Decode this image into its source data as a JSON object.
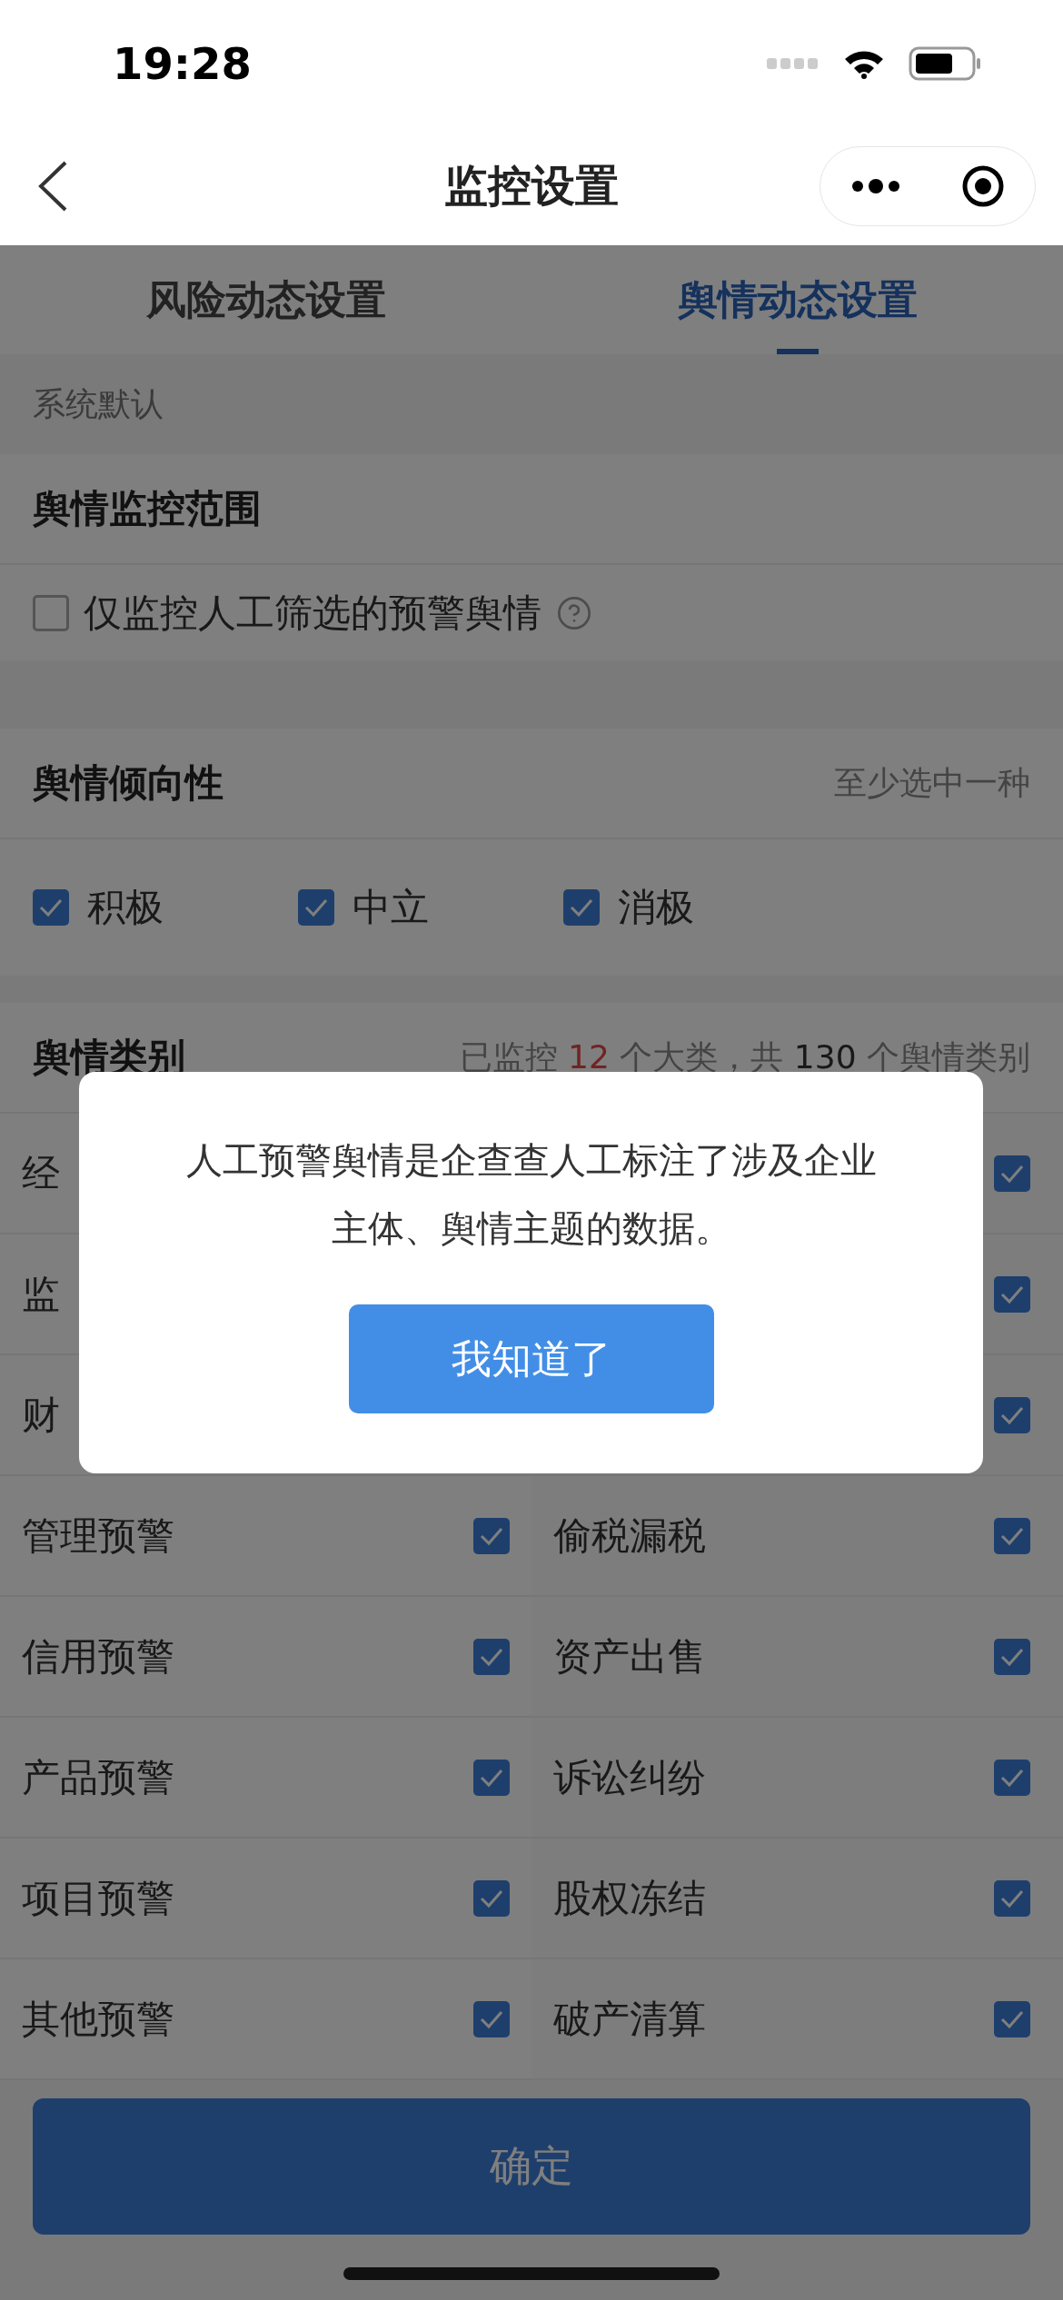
{
  "status_bar": {
    "time": "19:28"
  },
  "nav": {
    "title": "监控设置"
  },
  "tabs": [
    {
      "label": "风险动态设置",
      "selected": false
    },
    {
      "label": "舆情动态设置",
      "selected": true
    }
  ],
  "section_note": "系统默认",
  "scope": {
    "title": "舆情监控范围",
    "option": {
      "label": "仅监控人工筛选的预警舆情",
      "checked": false
    }
  },
  "tendency": {
    "title": "舆情倾向性",
    "hint": "至少选中一种",
    "options": [
      {
        "label": "积极",
        "checked": true
      },
      {
        "label": "中立",
        "checked": true
      },
      {
        "label": "消极",
        "checked": true
      }
    ]
  },
  "categories": {
    "title": "舆情类别",
    "summary": {
      "before": "已监控",
      "monitored": "12",
      "middle": "个大类，共",
      "total": "130",
      "after": "个舆情类别"
    },
    "rows": [
      [
        {
          "label": "经"
        },
        {
          "checked": true
        }
      ],
      [
        {
          "label": "监"
        },
        {
          "checked": true
        }
      ],
      [
        {
          "label": "财"
        },
        {
          "checked": true
        }
      ],
      [
        {
          "label": "管理预警",
          "checked": true
        },
        {
          "label": "偷税漏税",
          "checked": true
        }
      ],
      [
        {
          "label": "信用预警",
          "checked": true
        },
        {
          "label": "资产出售",
          "checked": true
        }
      ],
      [
        {
          "label": "产品预警",
          "checked": true
        },
        {
          "label": "诉讼纠纷",
          "checked": true
        }
      ],
      [
        {
          "label": "项目预警",
          "checked": true
        },
        {
          "label": "股权冻结",
          "checked": true
        }
      ],
      [
        {
          "label": "其他预警",
          "checked": true
        },
        {
          "label": "破产清算",
          "checked": true
        }
      ]
    ]
  },
  "confirm_button": "确定",
  "dialog": {
    "message": "人工预警舆情是企查查人工标注了涉及企业主体、舆情主题的数据。",
    "button": "我知道了"
  }
}
